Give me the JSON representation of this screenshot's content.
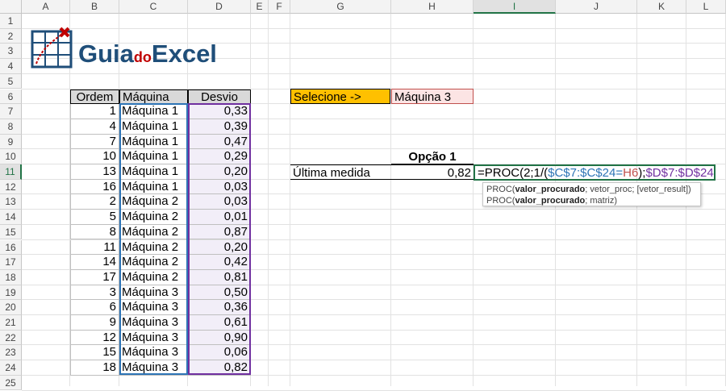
{
  "columns": [
    "A",
    "B",
    "C",
    "D",
    "E",
    "F",
    "G",
    "H",
    "I",
    "J",
    "K",
    "L"
  ],
  "rows": [
    "1",
    "2",
    "3",
    "4",
    "5",
    "6",
    "7",
    "8",
    "9",
    "10",
    "11",
    "12",
    "13",
    "14",
    "15",
    "16",
    "17",
    "18",
    "19",
    "20",
    "21",
    "22",
    "23",
    "24",
    "25"
  ],
  "logo": {
    "part1": "Guia",
    "part2": "do",
    "part3": "Excel"
  },
  "table": {
    "headers": [
      "Ordem",
      "Máquina",
      "Desvio"
    ],
    "rows": [
      [
        "1",
        "Máquina 1",
        "0,33"
      ],
      [
        "4",
        "Máquina 1",
        "0,39"
      ],
      [
        "7",
        "Máquina 1",
        "0,47"
      ],
      [
        "10",
        "Máquina 1",
        "0,29"
      ],
      [
        "13",
        "Máquina 1",
        "0,20"
      ],
      [
        "16",
        "Máquina 1",
        "0,03"
      ],
      [
        "2",
        "Máquina 2",
        "0,03"
      ],
      [
        "5",
        "Máquina 2",
        "0,01"
      ],
      [
        "8",
        "Máquina 2",
        "0,87"
      ],
      [
        "11",
        "Máquina 2",
        "0,20"
      ],
      [
        "14",
        "Máquina 2",
        "0,42"
      ],
      [
        "17",
        "Máquina 2",
        "0,81"
      ],
      [
        "3",
        "Máquina 3",
        "0,50"
      ],
      [
        "6",
        "Máquina 3",
        "0,36"
      ],
      [
        "9",
        "Máquina 3",
        "0,61"
      ],
      [
        "12",
        "Máquina 3",
        "0,90"
      ],
      [
        "15",
        "Máquina 3",
        "0,06"
      ],
      [
        "18",
        "Máquina 3",
        "0,82"
      ]
    ]
  },
  "selector": {
    "label": "Selecione ->",
    "value": "Máquina 3"
  },
  "result": {
    "header": "Opção 1",
    "label": "Última medida",
    "value": "0,82"
  },
  "formula": {
    "p1": "=PROC(",
    "p2": "2;1/(",
    "p3": "$C$7:$C$24",
    "p4": "=",
    "p5": "H6",
    "p6": ");",
    "p7": "$D$7:$D$24",
    "p8": ")"
  },
  "tooltip": {
    "line1_fn": "PROC(",
    "line1_bold": "valor_procurado",
    "line1_rest": "; vetor_proc; [vetor_result])",
    "line2_fn": "PROC(",
    "line2_bold": "valor_procurado",
    "line2_rest": "; matriz)"
  },
  "colors": {
    "blue_ref": "#2e75b6",
    "purple_ref": "#7030a0",
    "red_ref": "#c0504d",
    "selector_bg": "#ffc000"
  }
}
